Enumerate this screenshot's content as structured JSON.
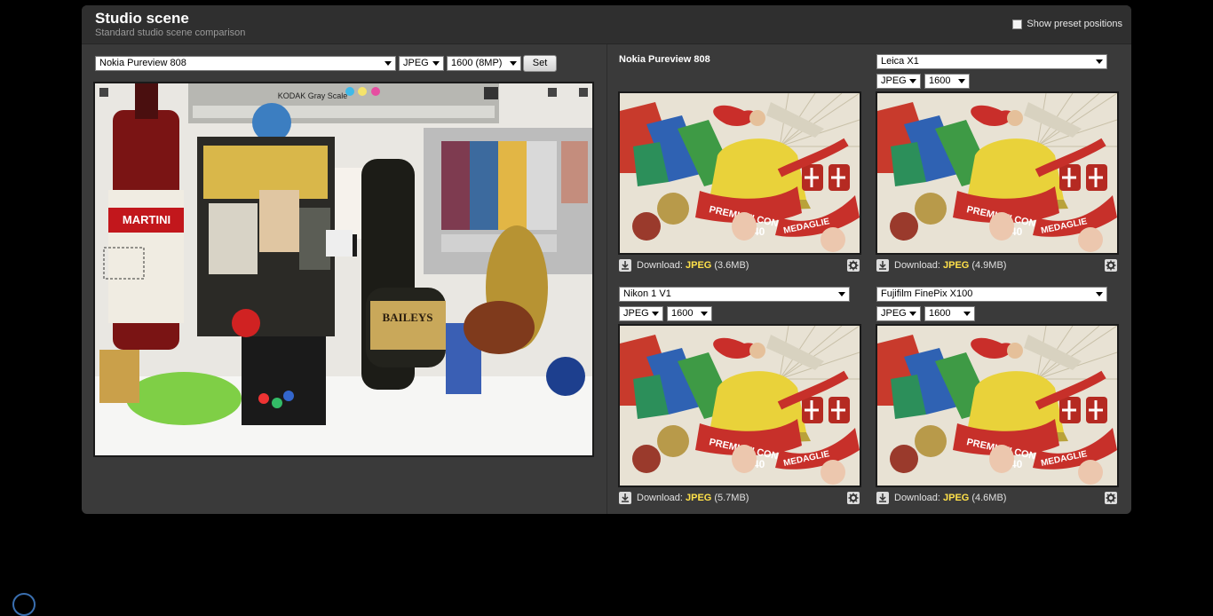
{
  "header": {
    "title": "Studio scene",
    "subtitle": "Standard studio scene comparison",
    "show_preset_label": "Show preset positions"
  },
  "main": {
    "camera": "Nokia Pureview 808",
    "format": "JPEG",
    "iso": "1600 (8MP)",
    "set_label": "Set"
  },
  "comparisons": [
    {
      "camera": "Nokia Pureview 808",
      "format": "",
      "iso": "",
      "download_label": "Download:",
      "download_format": "JPEG",
      "download_size": "(3.6MB)"
    },
    {
      "camera": "Leica X1",
      "format": "JPEG",
      "iso": "1600",
      "download_label": "Download:",
      "download_format": "JPEG",
      "download_size": "(4.9MB)"
    },
    {
      "camera": "Nikon 1 V1",
      "format": "JPEG",
      "iso": "1600",
      "download_label": "Download:",
      "download_format": "JPEG",
      "download_size": "(5.7MB)"
    },
    {
      "camera": "Fujifilm FinePix X100",
      "format": "JPEG",
      "iso": "1600",
      "download_label": "Download:",
      "download_format": "JPEG",
      "download_size": "(4.6MB)"
    }
  ],
  "scene_text": {
    "gray_scale": "KODAK Gray Scale",
    "martini": "MARTINI",
    "baileys": "BAILEYS",
    "banner": "PREMIATI CON",
    "banner2": "MEDAGLIE",
    "number": "40"
  },
  "colors": {
    "accent": "#ffe14a",
    "panel": "#3a3a3a",
    "header": "#2f2f2f"
  }
}
